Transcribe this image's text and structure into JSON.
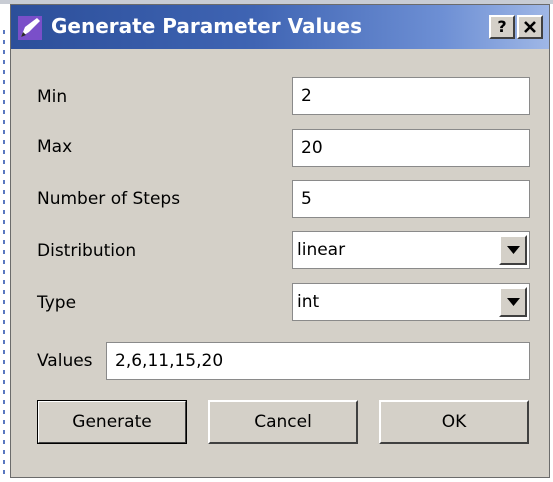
{
  "window": {
    "title": "Generate Parameter Values",
    "help_label": "?",
    "icon": "pen-icon",
    "close_icon": "close-icon"
  },
  "form": {
    "min_label": "Min",
    "min_value": "2",
    "max_label": "Max",
    "max_value": "20",
    "steps_label": "Number of Steps",
    "steps_value": "5",
    "distribution_label": "Distribution",
    "distribution_value": "linear",
    "type_label": "Type",
    "type_value": "int",
    "values_label": "Values",
    "values_value": "2,6,11,15,20"
  },
  "buttons": {
    "generate": "Generate",
    "cancel": "Cancel",
    "ok": "OK"
  },
  "colors": {
    "titlebar_start": "#2c4f9a",
    "titlebar_end": "#9fb7e6",
    "dialog_bg": "#d4d0c8"
  }
}
